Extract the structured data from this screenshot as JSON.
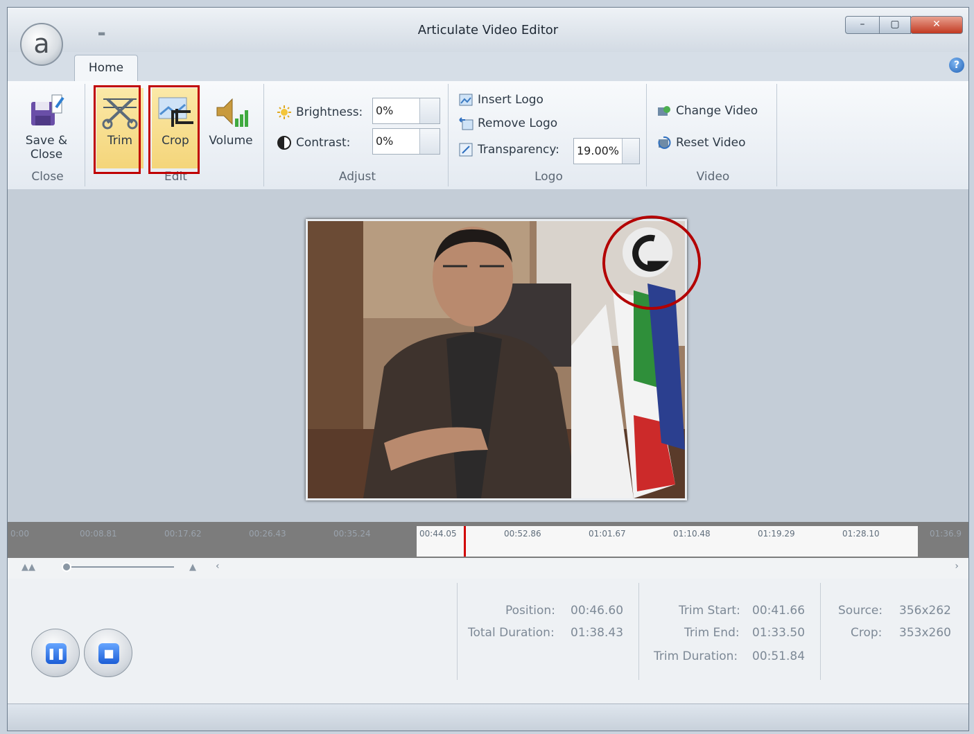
{
  "window": {
    "title": "Articulate Video Editor",
    "app_letter": "a"
  },
  "tabs": [
    {
      "label": "Home"
    }
  ],
  "help_glyph": "?",
  "ribbon": {
    "close": {
      "save_close_line1": "Save &",
      "save_close_line2": "Close",
      "group_label": "Close"
    },
    "edit": {
      "trim": "Trim",
      "crop": "Crop",
      "volume": "Volume",
      "group_label": "Edit"
    },
    "adjust": {
      "brightness_label": "Brightness:",
      "brightness_value": "0%",
      "contrast_label": "Contrast:",
      "contrast_value": "0%",
      "group_label": "Adjust"
    },
    "logo": {
      "insert": "Insert Logo",
      "remove": "Remove Logo",
      "transparency_label": "Transparency:",
      "transparency_value": "19.00%",
      "group_label": "Logo"
    },
    "video": {
      "change": "Change Video",
      "reset": "Reset Video",
      "group_label": "Video"
    }
  },
  "timeline": {
    "ticks_inactive": [
      "0:00",
      "00:08.81",
      "00:17.62",
      "00:26.43",
      "00:35.24"
    ],
    "ticks_active": [
      "00:44.05",
      "00:52.86",
      "01:01.67",
      "01:10.48",
      "01:19.29",
      "01:28.10"
    ],
    "tick_end": "01:36.9"
  },
  "info": {
    "position_label": "Position:",
    "position_value": "00:46.60",
    "total_label": "Total Duration:",
    "total_value": "01:38.43",
    "trim_start_label": "Trim Start:",
    "trim_start_value": "00:41.66",
    "trim_end_label": "Trim End:",
    "trim_end_value": "01:33.50",
    "trim_duration_label": "Trim Duration:",
    "trim_duration_value": "00:51.84",
    "source_label": "Source:",
    "source_value": "356x262",
    "crop_label": "Crop:",
    "crop_value": "353x260"
  },
  "colors": {
    "highlight_box": "#c00000",
    "selected_button": "#f4d57a",
    "playhead": "#d10000"
  }
}
